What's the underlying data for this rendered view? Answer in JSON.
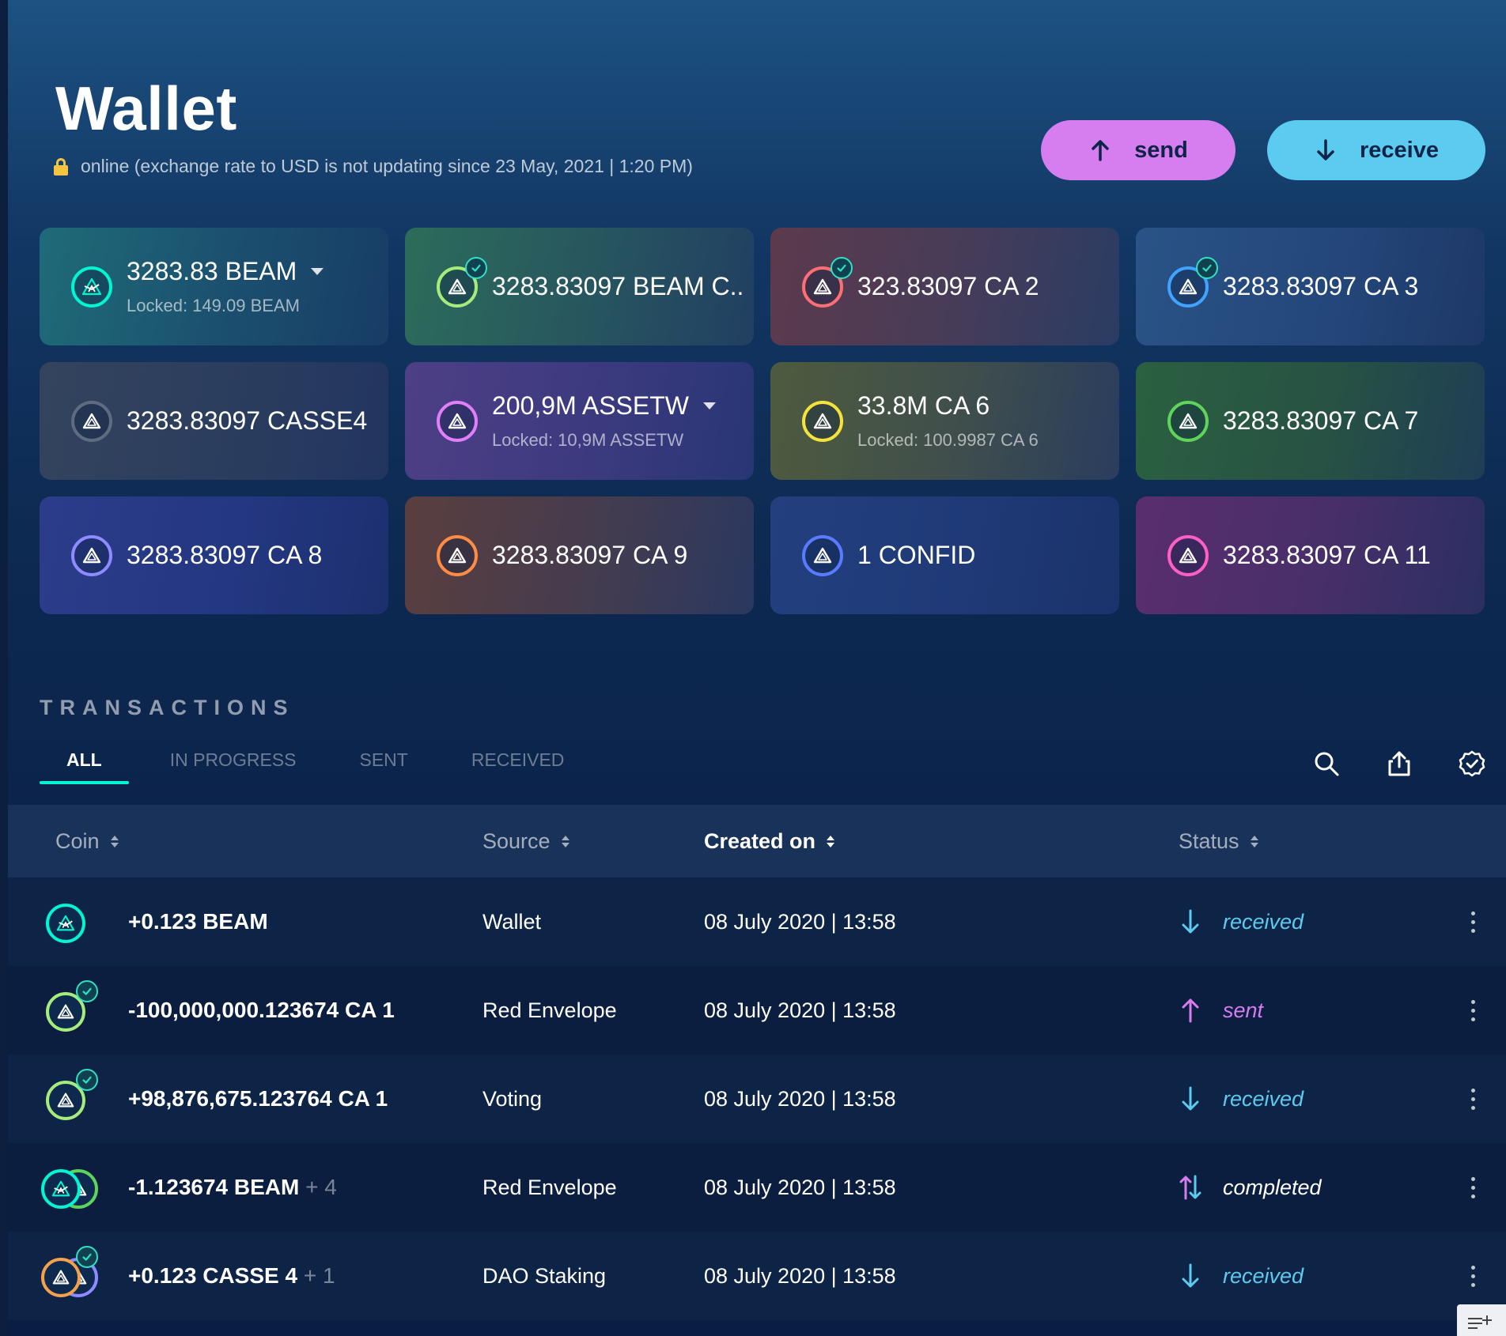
{
  "header": {
    "title": "Wallet",
    "status_text": "online (exchange rate to USD is not updating since 23 May, 2021 | 1:20 PM)",
    "send_label": "send",
    "receive_label": "receive"
  },
  "colors": {
    "send": "#d67df0",
    "receive": "#5ccbf0",
    "accent": "#00f6d2"
  },
  "assets": [
    {
      "amount": "3283.83 BEAM",
      "locked": "Locked: 149.09 BEAM",
      "dropdown": true,
      "verified": false,
      "icon": "beam-logo-icon",
      "ring": "#00f6d2",
      "bg": "linear-gradient(100deg,#1f6b78 0%,#1b4f6e 55%,#183d66 100%)"
    },
    {
      "amount": "3283.83097 BEAM C..",
      "locked": "",
      "dropdown": false,
      "verified": true,
      "icon": "asset-triangle-icon",
      "ring": "#72fdff",
      "ring2": "#a5ec7a",
      "bg": "linear-gradient(100deg,#2c6c5a 0%,#27555f 55%,#213f62 100%)"
    },
    {
      "amount": "323.83097 CA 2",
      "locked": "",
      "dropdown": false,
      "verified": true,
      "icon": "asset-triangle-icon",
      "ring": "#fc6f74",
      "bg": "linear-gradient(100deg,#5c3a4c 0%,#463c59 55%,#2a3c63 100%)"
    },
    {
      "amount": "3283.83097 CA 3",
      "locked": "",
      "dropdown": false,
      "verified": true,
      "icon": "asset-triangle-icon",
      "ring": "#3fa3ff",
      "bg": "linear-gradient(100deg,#2a5386 0%,#24477a 55%,#1d3868 100%)"
    },
    {
      "amount": "3283.83097 CASSE4",
      "locked": "",
      "dropdown": false,
      "verified": false,
      "icon": "asset-triangle-icon",
      "ring": "#5f6b80",
      "bg": "linear-gradient(100deg,#34445e 0%,#2b3d5e 55%,#223560 100%)"
    },
    {
      "amount": "200,9M ASSETW",
      "locked": "Locked: 10,9M ASSETW",
      "dropdown": true,
      "verified": false,
      "icon": "asset-triangle-icon",
      "ring": "#e07ff7",
      "bg": "linear-gradient(100deg,#4e3f86 0%,#3c3a7f 55%,#283675 100%)"
    },
    {
      "amount": "33.8M CA 6",
      "locked": "Locked: 100.9987 CA 6",
      "dropdown": false,
      "verified": false,
      "icon": "asset-triangle-icon",
      "ring": "#f5e23a",
      "bg": "linear-gradient(100deg,#4e5b3e 0%,#3f4e4c 55%,#2a3d5e 100%)"
    },
    {
      "amount": "3283.83097 CA 7",
      "locked": "",
      "dropdown": false,
      "verified": false,
      "icon": "asset-triangle-icon",
      "ring": "#5fd35a",
      "bg": "linear-gradient(100deg,#2b6040 0%,#275244 55%,#1f3e55 100%)"
    },
    {
      "amount": "3283.83097 CA 8",
      "locked": "",
      "dropdown": false,
      "verified": false,
      "icon": "asset-triangle-icon",
      "ring": "#8d8bff",
      "bg": "linear-gradient(100deg,#2c3c8a 0%,#243781 55%,#1c306f 100%)"
    },
    {
      "amount": "3283.83097 CA 9",
      "locked": "",
      "dropdown": false,
      "verified": false,
      "icon": "asset-triangle-icon",
      "ring": "#ff8b45",
      "bg": "linear-gradient(100deg,#5a3e3e 0%,#443c4f 55%,#2a3860 100%)"
    },
    {
      "amount": "1 CONFID",
      "locked": "",
      "dropdown": false,
      "verified": false,
      "icon": "asset-triangle-icon",
      "ring": "#5a7bff",
      "bg": "linear-gradient(100deg,#233f7e 0%,#1f3a77 55%,#1b336b 100%)"
    },
    {
      "amount": "3283.83097 CA 11",
      "locked": "",
      "dropdown": false,
      "verified": false,
      "icon": "asset-triangle-icon",
      "ring": "#ff5fc4",
      "bg": "linear-gradient(100deg,#5a2e6e 0%,#472f69 55%,#2b2f62 100%)"
    }
  ],
  "transactions": {
    "title": "TRANSACTIONS",
    "tabs": [
      {
        "label": "ALL",
        "active": true
      },
      {
        "label": "IN PROGRESS",
        "active": false
      },
      {
        "label": "SENT",
        "active": false
      },
      {
        "label": "RECEIVED",
        "active": false
      }
    ],
    "tools": [
      "search-icon",
      "export-icon",
      "verified-filter-icon"
    ],
    "columns": [
      {
        "label": "Coin",
        "active": false
      },
      {
        "label": "Source",
        "active": false
      },
      {
        "label": "Created on",
        "active": true
      },
      {
        "label": "Status",
        "active": false
      }
    ],
    "rows": [
      {
        "amount": "+0.123 BEAM",
        "more": "",
        "source": "Wallet",
        "date": "08 July 2020  | 13:58",
        "status": "received",
        "status_color": "#5ccbf0",
        "direction": "down",
        "icons": [
          {
            "ring": "#00f6d2",
            "kind": "beam"
          }
        ],
        "verified": false
      },
      {
        "amount": "-100,000,000.123674 CA 1",
        "more": "",
        "source": "Red Envelope",
        "date": "08 July 2020  | 13:58",
        "status": "sent",
        "status_color": "#d67df0",
        "direction": "up",
        "icons": [
          {
            "ring": "#a5ec7a",
            "kind": "asset"
          }
        ],
        "verified": true
      },
      {
        "amount": "+98,876,675.123764 CA 1",
        "more": "",
        "source": "Voting",
        "date": "08 July 2020  | 13:58",
        "status": "received",
        "status_color": "#5ccbf0",
        "direction": "down",
        "icons": [
          {
            "ring": "#a5ec7a",
            "kind": "asset"
          }
        ],
        "verified": true
      },
      {
        "amount": "-1.123674 BEAM",
        "more": "+ 4",
        "source": "Red Envelope",
        "date": "08 July 2020  | 13:58",
        "status": "completed",
        "status_color": "#ffffff",
        "direction": "both",
        "icons": [
          {
            "ring": "#00f6d2",
            "kind": "beam"
          },
          {
            "ring": "#5fd35a",
            "kind": "asset"
          }
        ],
        "verified": false
      },
      {
        "amount": "+0.123 CASSE 4",
        "more": "+ 1",
        "source": "DAO Staking",
        "date": "08 July 2020  | 13:58",
        "status": "received",
        "status_color": "#5ccbf0",
        "direction": "down",
        "icons": [
          {
            "ring": "#f5a04a",
            "kind": "asset"
          },
          {
            "ring": "#8d8bff",
            "kind": "asset"
          }
        ],
        "verified": true
      }
    ]
  }
}
